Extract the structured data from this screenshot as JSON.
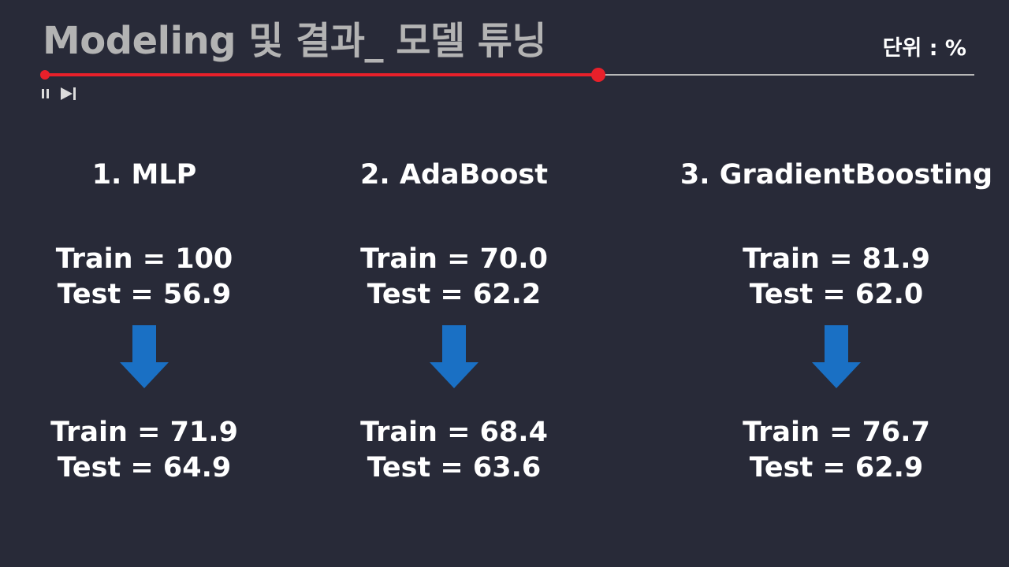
{
  "header": {
    "title": "Modeling 및 결과_ 모델 튜닝",
    "unit_label": "단위 : %"
  },
  "player": {
    "progress_percent": 59.5
  },
  "colors": {
    "background": "#282a38",
    "progress_red": "#e8202a",
    "arrow_blue": "#1a70c4",
    "title_gray": "#b3b3b3"
  },
  "models": [
    {
      "heading": "1. MLP",
      "before": {
        "train": "Train = 100",
        "test": "Test = 56.9"
      },
      "after": {
        "train": "Train = 71.9",
        "test": "Test = 64.9"
      }
    },
    {
      "heading": "2. AdaBoost",
      "before": {
        "train": "Train = 70.0",
        "test": "Test = 62.2"
      },
      "after": {
        "train": "Train = 68.4",
        "test": "Test = 63.6"
      }
    },
    {
      "heading": "3. GradientBoosting",
      "before": {
        "train": "Train = 81.9",
        "test": "Test = 62.0"
      },
      "after": {
        "train": "Train = 76.7",
        "test": "Test = 62.9"
      }
    }
  ]
}
